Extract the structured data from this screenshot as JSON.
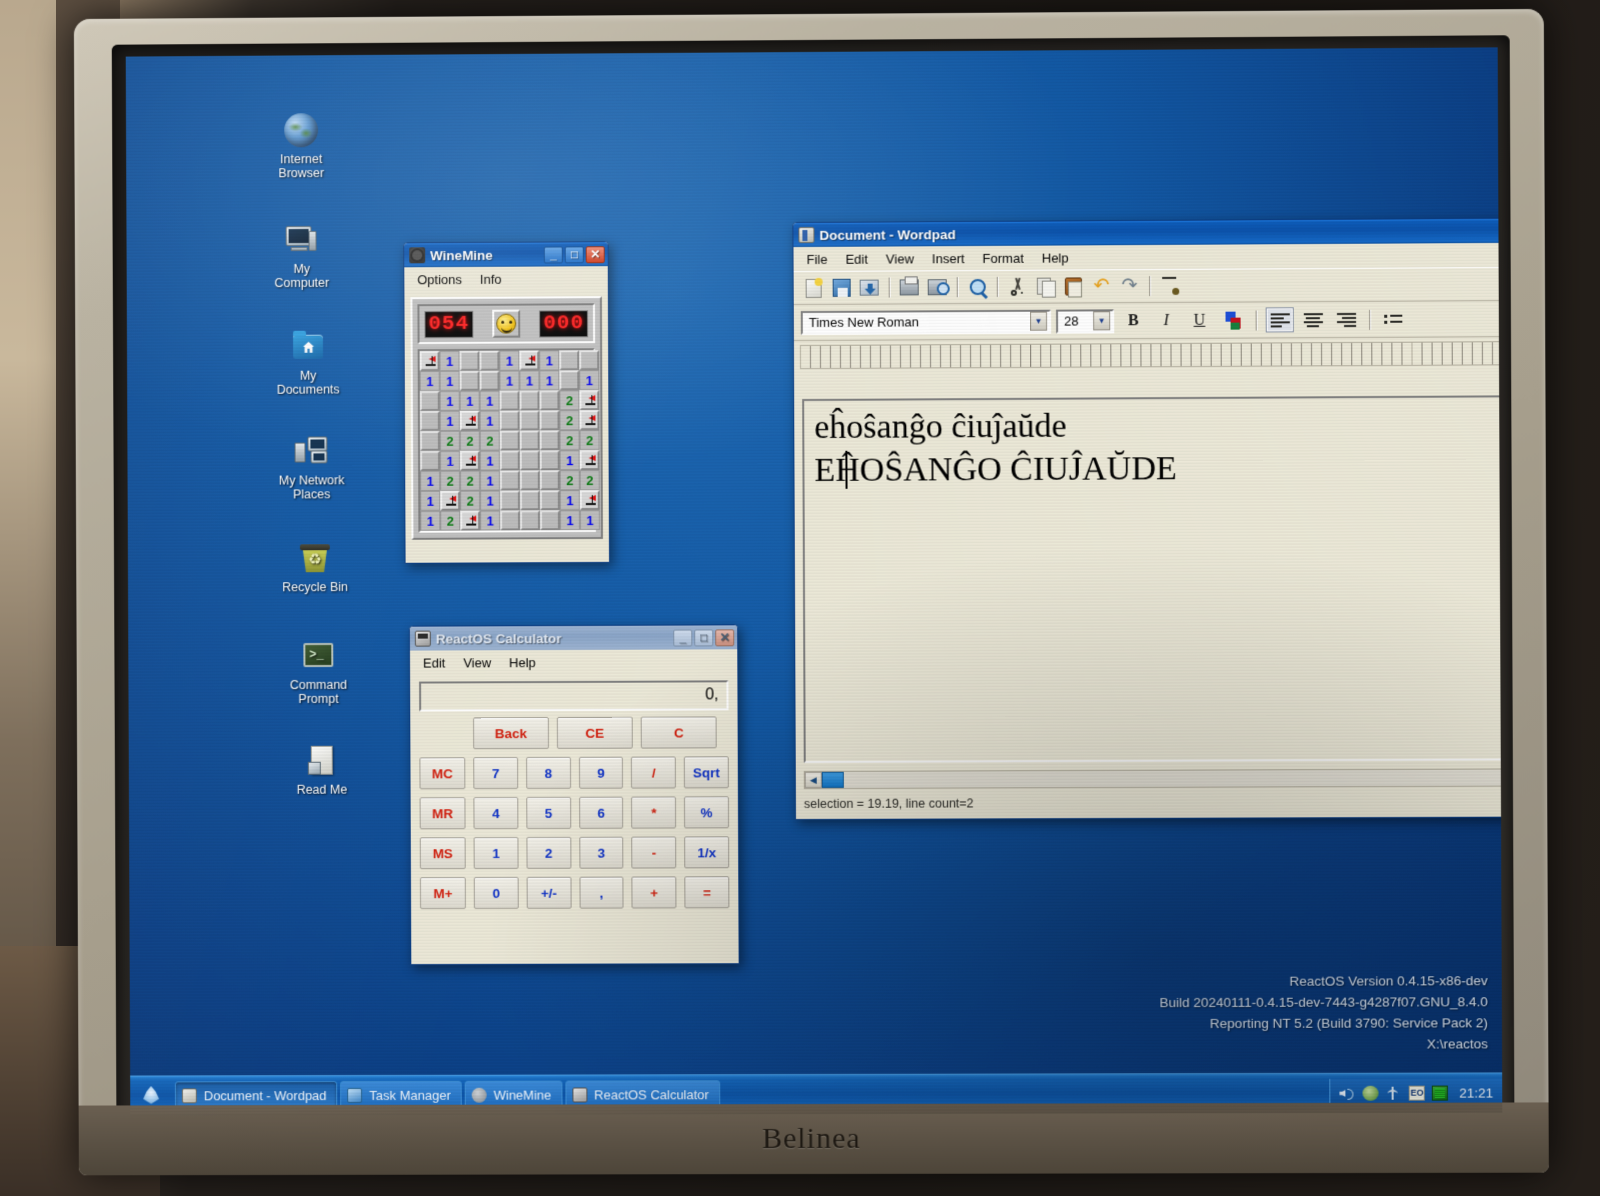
{
  "photo": {
    "monitor_brand": "Belinea"
  },
  "desktop": {
    "icons": [
      {
        "label": "Internet\nBrowser",
        "icon": "globe-icon"
      },
      {
        "label": "My\nComputer",
        "icon": "computer-icon"
      },
      {
        "label": "My\nDocuments",
        "icon": "documents-folder-icon"
      },
      {
        "label": "My Network\nPlaces",
        "icon": "network-icon"
      },
      {
        "label": "Recycle Bin",
        "icon": "recycle-bin-icon"
      },
      {
        "label": "Command\nPrompt",
        "icon": "command-prompt-icon"
      },
      {
        "label": "Read Me",
        "icon": "text-document-icon"
      }
    ],
    "version_info": [
      "ReactOS Version 0.4.15-x86-dev",
      "Build 20240111-0.4.15-dev-7443-g4287f07.GNU_8.4.0",
      "Reporting NT 5.2 (Build 3790: Service Pack 2)",
      "X:\\reactos"
    ]
  },
  "winemine": {
    "title": "WineMine",
    "menus": [
      "Options",
      "Info"
    ],
    "mine_counter": "054",
    "timer": "000",
    "face": "smiley-face",
    "buttons": {
      "minimize": "_",
      "maximize": "□",
      "close": "✕"
    },
    "grid": [
      [
        "F",
        "1",
        "",
        "",
        "1",
        "F",
        "1",
        "",
        ""
      ],
      [
        "1",
        "1",
        "",
        "",
        "1",
        "1",
        "1",
        "",
        "1"
      ],
      [
        "",
        "1",
        "1",
        "1",
        "",
        "",
        "",
        "2",
        "F"
      ],
      [
        "",
        "1",
        "F",
        "1",
        "",
        "",
        "",
        "2",
        "F"
      ],
      [
        "",
        "2",
        "2",
        "2",
        "",
        "",
        "",
        "2",
        "2"
      ],
      [
        "",
        "1",
        "F",
        "1",
        "",
        "",
        "",
        "1",
        "F"
      ],
      [
        "1",
        "2",
        "2",
        "1",
        "",
        "",
        "",
        "2",
        "2"
      ],
      [
        "1",
        "F",
        "2",
        "1",
        "",
        "",
        "",
        "1",
        "F"
      ],
      [
        "1",
        "2",
        "F",
        "1",
        "",
        "",
        "",
        "1",
        "1"
      ]
    ]
  },
  "calculator": {
    "title": "ReactOS Calculator",
    "menus": [
      "Edit",
      "View",
      "Help"
    ],
    "display": "0,",
    "buttons": {
      "minimize": "_",
      "maximize": "□",
      "close": "✕"
    },
    "rows": [
      [
        {
          "label": "",
          "kind": "spacer"
        },
        {
          "label": "Back",
          "kind": "red"
        },
        {
          "label": "CE",
          "kind": "red"
        },
        {
          "label": "C",
          "kind": "red"
        }
      ],
      [
        {
          "label": "MC",
          "kind": "red"
        },
        {
          "label": "7",
          "kind": "blue"
        },
        {
          "label": "8",
          "kind": "blue"
        },
        {
          "label": "9",
          "kind": "blue"
        },
        {
          "label": "/",
          "kind": "red"
        },
        {
          "label": "Sqrt",
          "kind": "blue"
        }
      ],
      [
        {
          "label": "MR",
          "kind": "red"
        },
        {
          "label": "4",
          "kind": "blue"
        },
        {
          "label": "5",
          "kind": "blue"
        },
        {
          "label": "6",
          "kind": "blue"
        },
        {
          "label": "*",
          "kind": "red"
        },
        {
          "label": "%",
          "kind": "blue"
        }
      ],
      [
        {
          "label": "MS",
          "kind": "red"
        },
        {
          "label": "1",
          "kind": "blue"
        },
        {
          "label": "2",
          "kind": "blue"
        },
        {
          "label": "3",
          "kind": "blue"
        },
        {
          "label": "-",
          "kind": "red"
        },
        {
          "label": "1/x",
          "kind": "blue"
        }
      ],
      [
        {
          "label": "M+",
          "kind": "red"
        },
        {
          "label": "0",
          "kind": "blue"
        },
        {
          "label": "+/-",
          "kind": "blue"
        },
        {
          "label": ",",
          "kind": "blue"
        },
        {
          "label": "+",
          "kind": "red"
        },
        {
          "label": "=",
          "kind": "red"
        }
      ]
    ]
  },
  "wordpad": {
    "title": "Document - Wordpad",
    "menus": [
      "File",
      "Edit",
      "View",
      "Insert",
      "Format",
      "Help"
    ],
    "buttons": {
      "minimize": "_",
      "maximize": "□",
      "close": "✕"
    },
    "toolbar_icons": [
      "new-icon",
      "save-icon",
      "open-icon",
      "print-icon",
      "print-preview-icon",
      "find-icon",
      "cut-icon",
      "copy-icon",
      "paste-icon",
      "undo-icon",
      "redo-icon",
      "date-time-icon"
    ],
    "font_name": "Times New Roman",
    "font_size": "28",
    "format_buttons": [
      "B",
      "I",
      "U"
    ],
    "document_lines": [
      "eĥoŝanĝo ĉiuĵaŭde",
      "EĤOŜANĜO ĈIUĴAŬDE"
    ],
    "status": "selection = 19.19, line count=2"
  },
  "taskbar": {
    "start_label": "start-logo",
    "items": [
      {
        "label": "Document - Wordpad",
        "icon": "wordpad-icon",
        "active": true
      },
      {
        "label": "Task Manager",
        "icon": "task-manager-icon",
        "active": false
      },
      {
        "label": "WineMine",
        "icon": "winemine-icon",
        "active": false
      },
      {
        "label": "ReactOS Calculator",
        "icon": "calculator-icon",
        "active": false
      }
    ],
    "tray_icons": [
      "volume-icon",
      "network-icon",
      "usb-icon",
      "keyboard-layout-icon",
      "screen-icon"
    ],
    "keyboard_layout": "EO",
    "clock": "21:21"
  },
  "colors": {
    "desktop_blue": "#0b3f85",
    "titlebar_blue": "#0d5cba",
    "face_yellow": "#f2c111",
    "led_red": "#ff1d1d",
    "mine_one_blue": "#0000f0",
    "mine_two_green": "#0a7a12"
  }
}
